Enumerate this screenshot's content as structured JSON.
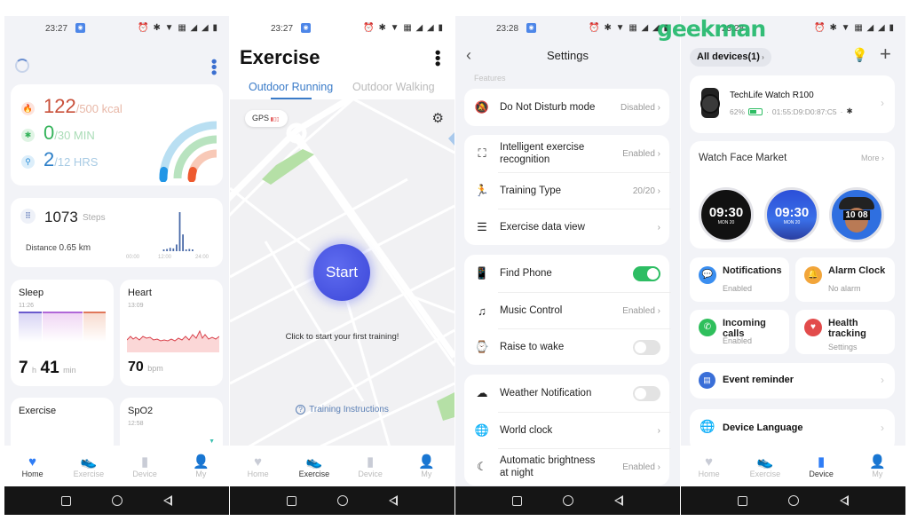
{
  "watermark": "geekman",
  "screens": {
    "home": {
      "status": {
        "time": "23:27",
        "icons": "⏰ ✱ ▼ ▦ ◢ ◢ ▮"
      },
      "activity": {
        "calories": {
          "value": "122",
          "goal": "/500 kcal",
          "progress": 0.244,
          "color": "#e0553a"
        },
        "exercise": {
          "value": "0",
          "goal": "/30 MIN",
          "progress": 0.0,
          "color": "#34b35a"
        },
        "stand": {
          "value": "2",
          "goal": "/12 HRS",
          "progress": 0.167,
          "color": "#2d8fd8"
        }
      },
      "steps": {
        "value": "1073",
        "unit": "Steps",
        "distance_label": "Distance",
        "distance_value": "0.65 km",
        "x_labels": [
          "00:00",
          "12:00",
          "24:00"
        ],
        "hourly": [
          0,
          0,
          0,
          0,
          0,
          0,
          0,
          0,
          0,
          0,
          0,
          2,
          4,
          6,
          5,
          12,
          70,
          30,
          3,
          4,
          3,
          0,
          0,
          0
        ]
      },
      "sleep": {
        "label": "Sleep",
        "time": "11:26",
        "hours": "7",
        "h_unit": "h",
        "minutes": "41",
        "m_unit": "min"
      },
      "heart": {
        "label": "Heart",
        "time": "13:09",
        "value": "70",
        "unit": "bpm"
      },
      "exercise_card": {
        "label": "Exercise"
      },
      "spo2": {
        "label": "SpO2",
        "time": "12:58"
      }
    },
    "exercise": {
      "status": {
        "time": "23:27",
        "icons": "⏰ ✱ ▼ ▦ ◢ ◢ ▮"
      },
      "title": "Exercise",
      "tabs": [
        {
          "label": "Outdoor Running",
          "active": true
        },
        {
          "label": "Outdoor Walking",
          "active": false
        }
      ],
      "gps_label": "GPS",
      "start_label": "Start",
      "hint": "Click to start your first training!",
      "instructions": "Training Instructions"
    },
    "settings": {
      "status": {
        "time": "23:28",
        "icons": "⏰ ✱ ▼ ▦ ◢ ◢ ▮"
      },
      "title": "Settings",
      "section": "Features",
      "rows": [
        {
          "label": "Do Not Disturb mode",
          "value": "Disabled",
          "icon": "bell-off"
        },
        {
          "label": "Intelligent exercise recognition",
          "value": "Enabled",
          "icon": "exercise-scan"
        },
        {
          "label": "Training Type",
          "value": "20/20",
          "icon": "runner"
        },
        {
          "label": "Exercise data view",
          "value": "",
          "icon": "bars"
        },
        {
          "label": "Find Phone",
          "toggle": true,
          "icon": "phone-find"
        },
        {
          "label": "Music Control",
          "value": "Enabled",
          "icon": "music"
        },
        {
          "label": "Raise to wake",
          "toggle": false,
          "icon": "watch"
        },
        {
          "label": "Weather Notification",
          "toggle": false,
          "icon": "weather"
        },
        {
          "label": "World clock",
          "value": "",
          "icon": "globe-clock"
        },
        {
          "label": "Automatic brightness at night",
          "value": "Enabled",
          "icon": "moon"
        }
      ]
    },
    "device": {
      "status": {
        "time": "23:28",
        "icons": "⏰ ✱ ▼ ▦ ◢ ◢ ▮"
      },
      "all_devices": "All devices(1)",
      "device_name": "TechLife Watch R100",
      "battery": "62%",
      "battery_level": 0.62,
      "mac": "01:55:D9:D0:87:C5",
      "watch_face_title": "Watch Face Market",
      "more": "More",
      "faces": [
        {
          "time": "09:30",
          "date": "MON 20"
        },
        {
          "time": "09:30",
          "date": "MON 20"
        },
        {
          "time": "10 08",
          "date": ""
        }
      ],
      "tiles": [
        {
          "title": "Notifications",
          "sub": "Enabled",
          "color": "#3a8ef0"
        },
        {
          "title": "Alarm Clock",
          "sub": "No alarm",
          "color": "#f2a53a"
        },
        {
          "title": "Incoming calls",
          "sub": "Enabled",
          "color": "#2fbf5c"
        },
        {
          "title": "Health tracking",
          "sub": "Settings",
          "color": "#e24b4b"
        }
      ],
      "event_reminder": "Event reminder",
      "device_language": "Device Language"
    }
  },
  "navbar": [
    {
      "label": "Home",
      "icon": "heart"
    },
    {
      "label": "Exercise",
      "icon": "shoe"
    },
    {
      "label": "Device",
      "icon": "watch"
    },
    {
      "label": "My",
      "icon": "person"
    }
  ]
}
